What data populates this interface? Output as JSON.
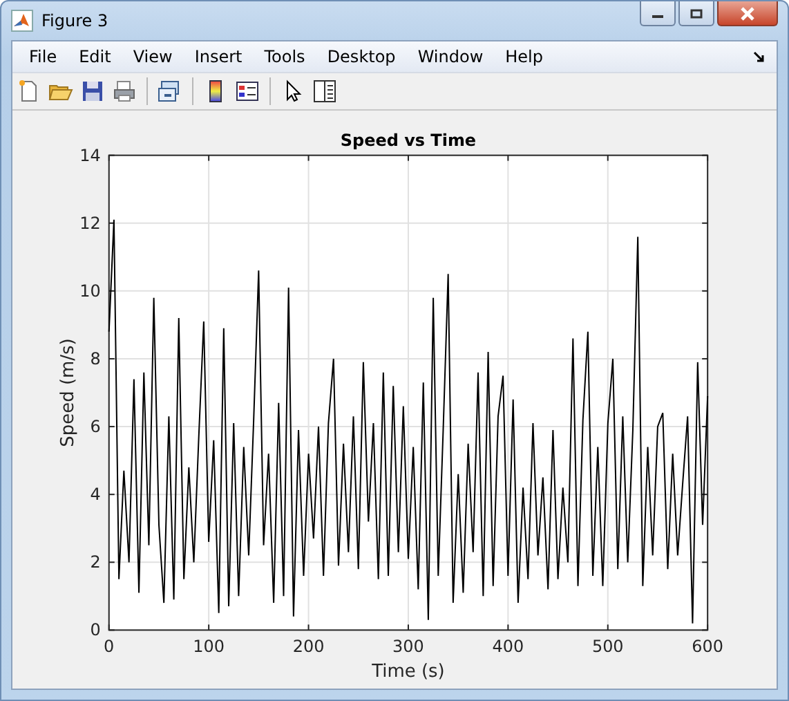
{
  "window": {
    "title": "Figure 3"
  },
  "menu": [
    "File",
    "Edit",
    "View",
    "Insert",
    "Tools",
    "Desktop",
    "Window",
    "Help"
  ],
  "figure": {
    "chart_data": {
      "type": "line",
      "title": "Speed vs Time",
      "xlabel": "Time (s)",
      "ylabel": "Speed (m/s)",
      "xlim": [
        0,
        600
      ],
      "ylim": [
        0,
        14
      ],
      "xticks": [
        0,
        100,
        200,
        300,
        400,
        500,
        600
      ],
      "yticks": [
        0,
        2,
        4,
        6,
        8,
        10,
        12,
        14
      ],
      "grid": true,
      "x": [
        0,
        5,
        10,
        15,
        20,
        25,
        30,
        35,
        40,
        45,
        50,
        55,
        60,
        65,
        70,
        75,
        80,
        85,
        90,
        95,
        100,
        105,
        110,
        115,
        120,
        125,
        130,
        135,
        140,
        145,
        150,
        155,
        160,
        165,
        170,
        175,
        180,
        185,
        190,
        195,
        200,
        205,
        210,
        215,
        220,
        225,
        230,
        235,
        240,
        245,
        250,
        255,
        260,
        265,
        270,
        275,
        280,
        285,
        290,
        295,
        300,
        305,
        310,
        315,
        320,
        325,
        330,
        335,
        340,
        345,
        350,
        355,
        360,
        365,
        370,
        375,
        380,
        385,
        390,
        395,
        400,
        405,
        410,
        415,
        420,
        425,
        430,
        435,
        440,
        445,
        450,
        455,
        460,
        465,
        470,
        475,
        480,
        485,
        490,
        495,
        500,
        505,
        510,
        515,
        520,
        525,
        530,
        535,
        540,
        545,
        550,
        555,
        560,
        565,
        570,
        575,
        580,
        585,
        590,
        595,
        600
      ],
      "series": [
        {
          "color": "#000000",
          "values": [
            8.8,
            12.1,
            1.5,
            4.7,
            2.0,
            7.4,
            1.1,
            7.6,
            2.5,
            9.8,
            3.1,
            0.8,
            6.3,
            0.9,
            9.2,
            1.5,
            4.8,
            2.0,
            5.7,
            9.1,
            2.6,
            5.6,
            0.5,
            8.9,
            0.7,
            6.1,
            1.0,
            5.4,
            2.2,
            6.2,
            10.6,
            2.5,
            5.2,
            0.8,
            6.7,
            1.0,
            10.1,
            0.4,
            5.9,
            1.6,
            5.2,
            2.7,
            6.0,
            1.6,
            6.1,
            8.0,
            1.9,
            5.5,
            2.3,
            6.3,
            1.8,
            7.9,
            3.2,
            6.1,
            1.5,
            7.6,
            1.6,
            7.2,
            2.3,
            6.6,
            2.1,
            5.4,
            1.2,
            7.3,
            0.3,
            9.8,
            1.6,
            5.9,
            10.5,
            0.8,
            4.6,
            1.1,
            5.5,
            2.3,
            7.6,
            1.0,
            8.2,
            1.3,
            6.3,
            7.5,
            1.6,
            6.8,
            0.8,
            4.2,
            1.5,
            6.1,
            2.2,
            4.5,
            1.2,
            5.9,
            1.5,
            4.2,
            2.0,
            8.6,
            1.3,
            6.2,
            8.8,
            1.6,
            5.4,
            1.3,
            6.1,
            8.0,
            1.8,
            6.3,
            2.0,
            5.9,
            11.6,
            1.3,
            5.4,
            2.2,
            6.0,
            6.4,
            1.8,
            5.2,
            2.2,
            4.3,
            6.3,
            0.2,
            7.9,
            3.1,
            6.9
          ]
        }
      ]
    }
  }
}
